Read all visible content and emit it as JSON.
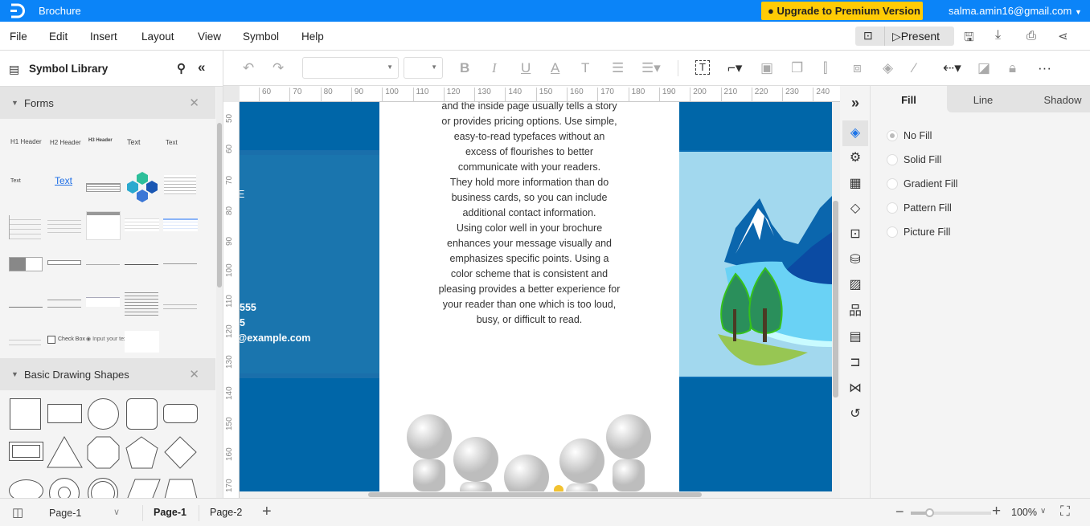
{
  "app": {
    "title": "Brochure",
    "upgrade_label": "Upgrade to Premium Version",
    "user_email": "salma.amin16@gmail.com",
    "accent": "#0b84f8",
    "upgrade_color": "#ffcb05"
  },
  "menu": [
    "File",
    "Edit",
    "Insert",
    "Layout",
    "View",
    "Symbol",
    "Help"
  ],
  "header_actions": {
    "present_label": "Present",
    "icons": [
      "presentation-icon",
      "save-icon",
      "download-icon",
      "print-icon",
      "share-icon"
    ]
  },
  "toolbar": {
    "font_family": "",
    "font_size": "",
    "icons": [
      "undo-icon",
      "redo-icon",
      "bold-icon",
      "italic-icon",
      "underline-icon",
      "font-color-icon",
      "text-style-icon",
      "align-icon",
      "line-spacing-icon",
      "text-box-icon",
      "connector-icon",
      "front-icon",
      "back-icon",
      "align-objects-icon",
      "group-icon",
      "fill-icon",
      "brush-icon",
      "line-style-icon",
      "edit-shape-icon",
      "lock-icon",
      "more-icon"
    ]
  },
  "library": {
    "title": "Symbol Library",
    "sections": [
      {
        "name": "Forms",
        "items": [
          "H1 Header",
          "H2 Header",
          "H3 Header",
          "Text",
          "Text",
          "Text",
          "Text",
          "Check Box",
          "Input your text."
        ]
      },
      {
        "name": "Basic Drawing Shapes"
      }
    ]
  },
  "ruler": {
    "top": [
      "60",
      "70",
      "80",
      "90",
      "100",
      "110",
      "120",
      "130",
      "140",
      "150",
      "160",
      "170",
      "180",
      "190",
      "200",
      "210",
      "220",
      "230",
      "240"
    ],
    "left": [
      "50",
      "60",
      "70",
      "80",
      "90",
      "100",
      "110",
      "120",
      "130",
      "140",
      "150",
      "160",
      "170"
    ]
  },
  "brochure": {
    "body_text": [
      "and the inside page usually tells a story",
      "or provides pricing options. Use simple,",
      "easy-to-read typefaces without an",
      "excess of flourishes to better",
      "communicate with your readers.",
      "They hold more information than do",
      "business cards, so you can include",
      "additional contact information.",
      "Using color well in your brochure",
      "enhances your message visually and",
      "emphasizes specific points. Using a",
      "color scheme that is consistent and",
      "pleasing provides a better experience for",
      "your reader than one which is too loud,",
      "busy, or difficult to read."
    ],
    "left_panel_text": [
      "E",
      "555",
      "5",
      "@example.com"
    ],
    "colors": {
      "dark_blue": "#0066a8",
      "band_left": "#1a75ae",
      "band_right": "#a2d8ee"
    }
  },
  "properties": {
    "tabs": [
      "Fill",
      "Line",
      "Shadow"
    ],
    "active_tab": "Fill",
    "fill_options": [
      "No Fill",
      "Solid Fill",
      "Gradient Fill",
      "Pattern Fill",
      "Picture Fill"
    ],
    "selected": "No Fill"
  },
  "side_icons": [
    "expand-icon",
    "fill-icon",
    "shape-settings-icon",
    "grid-icon",
    "layers-icon",
    "presentation-icon",
    "data-icon",
    "image-icon",
    "org-chart-icon",
    "table-icon",
    "timeline-icon",
    "mind-map-icon",
    "history-icon"
  ],
  "bottom": {
    "page_select": "Page-1",
    "pages": [
      "Page-1",
      "Page-2"
    ],
    "active_page": "Page-1",
    "zoom": "100%",
    "zoom_level": 100
  }
}
